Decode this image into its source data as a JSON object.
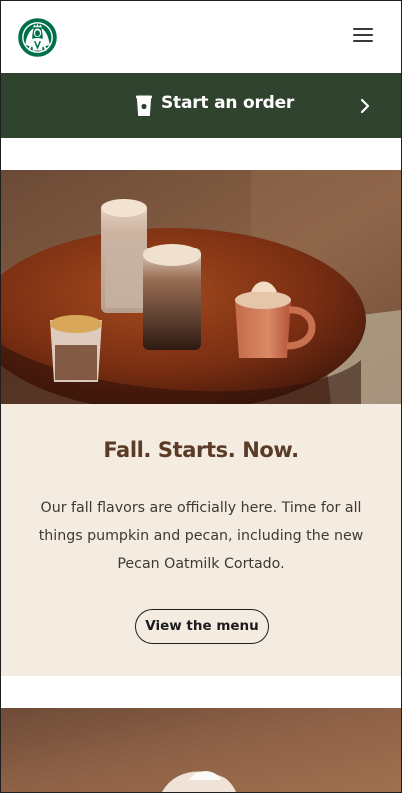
{
  "header": {
    "logo": "starbucks-siren-logo",
    "menu_icon": "hamburger-menu-icon"
  },
  "order_bar": {
    "label": "Start an order",
    "icon": "cup-icon",
    "chevron": "chevron-right-icon",
    "background": "#30432f"
  },
  "promo": {
    "title": "Fall. Starts. Now.",
    "body": "Our fall flavors are officially here. Time for all things pumpkin and pecan, including the new Pecan Oatmilk Cortado.",
    "button_label": "View the menu",
    "background": "#f4ebe1",
    "title_color": "#5a3b27"
  },
  "images": {
    "hero": "fall-drinks-on-wooden-table",
    "secondary": "drink-on-brown-background"
  }
}
